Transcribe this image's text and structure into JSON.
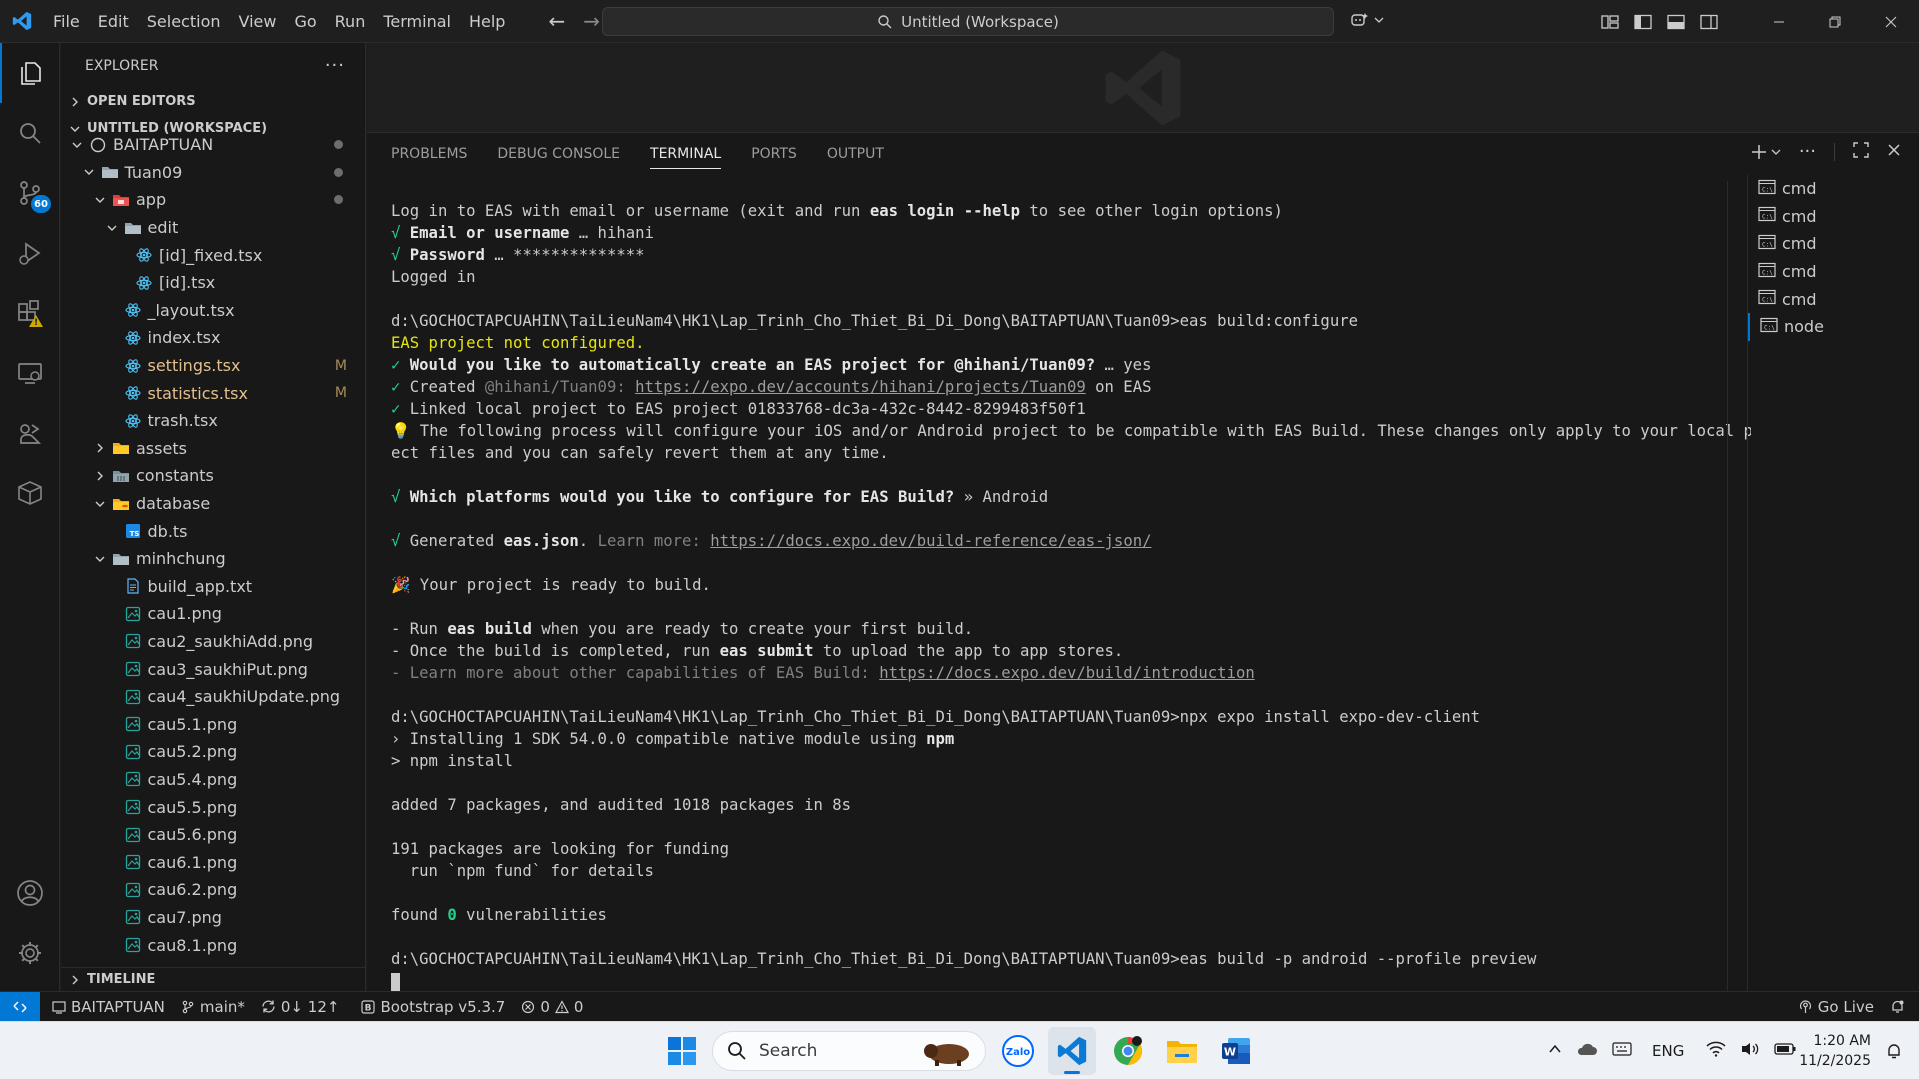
{
  "menubar": [
    "File",
    "Edit",
    "Selection",
    "View",
    "Go",
    "Run",
    "Terminal",
    "Help"
  ],
  "command_center": "Untitled (Workspace)",
  "activity": {
    "scm_badge": "60"
  },
  "explorer": {
    "title": "EXPLORER",
    "open_editors": "OPEN EDITORS",
    "workspace": "UNTITLED (WORKSPACE)",
    "timeline": "TIMELINE",
    "rows": [
      {
        "label": "BAITAPTUAN",
        "depth": 1,
        "kind": "repo",
        "chev": "down",
        "decor": "dot"
      },
      {
        "label": "Tuan09",
        "depth": 2,
        "kind": "folder",
        "chev": "down",
        "decor": "dot"
      },
      {
        "label": "app",
        "depth": 3,
        "kind": "app-folder",
        "chev": "down",
        "decor": "dot"
      },
      {
        "label": "edit",
        "depth": 4,
        "kind": "folder",
        "chev": "down",
        "decor": ""
      },
      {
        "label": "[id]_fixed.tsx",
        "depth": 5,
        "kind": "react",
        "chev": "",
        "decor": ""
      },
      {
        "label": "[id].tsx",
        "depth": 5,
        "kind": "react",
        "chev": "",
        "decor": ""
      },
      {
        "label": "_layout.tsx",
        "depth": 4,
        "kind": "react",
        "chev": "",
        "decor": ""
      },
      {
        "label": "index.tsx",
        "depth": 4,
        "kind": "react",
        "chev": "",
        "decor": ""
      },
      {
        "label": "settings.tsx",
        "depth": 4,
        "kind": "react",
        "chev": "",
        "decor": "M"
      },
      {
        "label": "statistics.tsx",
        "depth": 4,
        "kind": "react",
        "chev": "",
        "decor": "M"
      },
      {
        "label": "trash.tsx",
        "depth": 4,
        "kind": "react",
        "chev": "",
        "decor": ""
      },
      {
        "label": "assets",
        "depth": 3,
        "kind": "folder-yellow",
        "chev": "right",
        "decor": ""
      },
      {
        "label": "constants",
        "depth": 3,
        "kind": "folder-grid",
        "chev": "right",
        "decor": ""
      },
      {
        "label": "database",
        "depth": 3,
        "kind": "folder-db",
        "chev": "down",
        "decor": ""
      },
      {
        "label": "db.ts",
        "depth": 4,
        "kind": "ts",
        "chev": "",
        "decor": ""
      },
      {
        "label": "minhchung",
        "depth": 3,
        "kind": "folder",
        "chev": "down",
        "decor": ""
      },
      {
        "label": "build_app.txt",
        "depth": 4,
        "kind": "txt",
        "chev": "",
        "decor": ""
      },
      {
        "label": "cau1.png",
        "depth": 4,
        "kind": "img",
        "chev": "",
        "decor": ""
      },
      {
        "label": "cau2_saukhiAdd.png",
        "depth": 4,
        "kind": "img",
        "chev": "",
        "decor": ""
      },
      {
        "label": "cau3_saukhiPut.png",
        "depth": 4,
        "kind": "img",
        "chev": "",
        "decor": ""
      },
      {
        "label": "cau4_saukhiUpdate.png",
        "depth": 4,
        "kind": "img",
        "chev": "",
        "decor": ""
      },
      {
        "label": "cau5.1.png",
        "depth": 4,
        "kind": "img",
        "chev": "",
        "decor": ""
      },
      {
        "label": "cau5.2.png",
        "depth": 4,
        "kind": "img",
        "chev": "",
        "decor": ""
      },
      {
        "label": "cau5.4.png",
        "depth": 4,
        "kind": "img",
        "chev": "",
        "decor": ""
      },
      {
        "label": "cau5.5.png",
        "depth": 4,
        "kind": "img",
        "chev": "",
        "decor": ""
      },
      {
        "label": "cau5.6.png",
        "depth": 4,
        "kind": "img",
        "chev": "",
        "decor": ""
      },
      {
        "label": "cau6.1.png",
        "depth": 4,
        "kind": "img",
        "chev": "",
        "decor": ""
      },
      {
        "label": "cau6.2.png",
        "depth": 4,
        "kind": "img",
        "chev": "",
        "decor": ""
      },
      {
        "label": "cau7.png",
        "depth": 4,
        "kind": "img",
        "chev": "",
        "decor": ""
      },
      {
        "label": "cau8.1.png",
        "depth": 4,
        "kind": "img",
        "chev": "",
        "decor": ""
      }
    ]
  },
  "panel": {
    "tabs": [
      "PROBLEMS",
      "DEBUG CONSOLE",
      "TERMINAL",
      "PORTS",
      "OUTPUT"
    ],
    "active_tab": "TERMINAL"
  },
  "terminal_lines": [
    [
      {
        "t": "Log in to EAS with email or username (exit and run "
      },
      {
        "t": "eas login --help",
        "c": "bold"
      },
      {
        "t": " to see other login options)"
      }
    ],
    [
      {
        "t": "√ ",
        "c": "green"
      },
      {
        "t": "Email or username",
        "c": "bold"
      },
      {
        "t": " … hihani"
      }
    ],
    [
      {
        "t": "√ ",
        "c": "green"
      },
      {
        "t": "Password",
        "c": "bold"
      },
      {
        "t": " … **************"
      }
    ],
    [
      {
        "t": "Logged in"
      }
    ],
    [
      {
        "t": ""
      }
    ],
    [
      {
        "t": "d:\\GOCHOCTAPCUAHIN\\TaiLieuNam4\\HK1\\Lap_Trinh_Cho_Thiet_Bi_Di_Dong\\BAITAPTUAN\\Tuan09>eas build:configure"
      }
    ],
    [
      {
        "t": "EAS project not configured.",
        "c": "yellow"
      }
    ],
    [
      {
        "t": "✓ ",
        "c": "green"
      },
      {
        "t": "Would you like to automatically create an EAS project for @hihani/Tuan09?",
        "c": "bold"
      },
      {
        "t": " … yes"
      }
    ],
    [
      {
        "t": "✓ ",
        "c": "green"
      },
      {
        "t": "Created "
      },
      {
        "t": "@hihani/Tuan09",
        "c": "dim"
      },
      {
        "t": ": ",
        "c": "dim"
      },
      {
        "t": "https://expo.dev/accounts/hihani/projects/Tuan09",
        "c": "link"
      },
      {
        "t": " on EAS"
      }
    ],
    [
      {
        "t": "✓ ",
        "c": "green"
      },
      {
        "t": "Linked local project to EAS project 01833768-dc3a-432c-8442-8299483f50f1"
      }
    ],
    [
      {
        "t": "💡 The following process will configure your iOS and/or Android project to be compatible with EAS Build. These changes only apply to your local proj"
      }
    ],
    [
      {
        "t": "ect files and you can safely revert them at any time."
      }
    ],
    [
      {
        "t": ""
      }
    ],
    [
      {
        "t": "√ ",
        "c": "green"
      },
      {
        "t": "Which platforms would you like to configure for EAS Build?",
        "c": "bold"
      },
      {
        "t": " » Android"
      }
    ],
    [
      {
        "t": ""
      }
    ],
    [
      {
        "t": "√ ",
        "c": "green"
      },
      {
        "t": "Generated "
      },
      {
        "t": "eas.json",
        "c": "bold"
      },
      {
        "t": ". "
      },
      {
        "t": "Learn more: ",
        "c": "dim"
      },
      {
        "t": "https://docs.expo.dev/build-reference/eas-json/",
        "c": "link"
      }
    ],
    [
      {
        "t": ""
      }
    ],
    [
      {
        "t": "🎉 Your project is ready to build."
      }
    ],
    [
      {
        "t": ""
      }
    ],
    [
      {
        "t": "- Run "
      },
      {
        "t": "eas build",
        "c": "bold"
      },
      {
        "t": " when you are ready to create your first build."
      }
    ],
    [
      {
        "t": "- Once the build is completed, run "
      },
      {
        "t": "eas submit",
        "c": "bold"
      },
      {
        "t": " to upload the app to app stores."
      }
    ],
    [
      {
        "t": "- Learn more about other capabilities of EAS Build: ",
        "c": "dim"
      },
      {
        "t": "https://docs.expo.dev/build/introduction",
        "c": "link"
      }
    ],
    [
      {
        "t": ""
      }
    ],
    [
      {
        "t": "d:\\GOCHOCTAPCUAHIN\\TaiLieuNam4\\HK1\\Lap_Trinh_Cho_Thiet_Bi_Di_Dong\\BAITAPTUAN\\Tuan09>npx expo install expo-dev-client"
      }
    ],
    [
      {
        "t": "› Installing 1 SDK 54.0.0 compatible native module using "
      },
      {
        "t": "npm",
        "c": "bold"
      }
    ],
    [
      {
        "t": "> npm install"
      }
    ],
    [
      {
        "t": ""
      }
    ],
    [
      {
        "t": "added 7 packages, and audited 1018 packages in 8s"
      }
    ],
    [
      {
        "t": ""
      }
    ],
    [
      {
        "t": "191 packages are looking for funding"
      }
    ],
    [
      {
        "t": "  run `npm fund` for details"
      }
    ],
    [
      {
        "t": ""
      }
    ],
    [
      {
        "t": "found "
      },
      {
        "t": "0",
        "c": "greenb"
      },
      {
        "t": " vulnerabilities"
      }
    ],
    [
      {
        "t": ""
      }
    ],
    [
      {
        "t": "d:\\GOCHOCTAPCUAHIN\\TaiLieuNam4\\HK1\\Lap_Trinh_Cho_Thiet_Bi_Di_Dong\\BAITAPTUAN\\Tuan09>eas build -p android --profile preview"
      }
    ]
  ],
  "terminal_list": [
    "cmd",
    "cmd",
    "cmd",
    "cmd",
    "cmd",
    "node"
  ],
  "statusbar": {
    "workspace": "BAITAPTUAN",
    "branch": "main*",
    "sync": "0↓ 12↑",
    "bootstrap": "Bootstrap v5.3.7",
    "errors": "0",
    "warnings": "0",
    "golive": "Go Live"
  },
  "taskbar": {
    "search": "Search",
    "lang": "ENG",
    "time": "1:20 AM",
    "date": "11/2/2025"
  },
  "colors": {
    "accent": "#0078d4",
    "terminal_green": "#23d18b",
    "terminal_yellow": "#e5e510"
  }
}
